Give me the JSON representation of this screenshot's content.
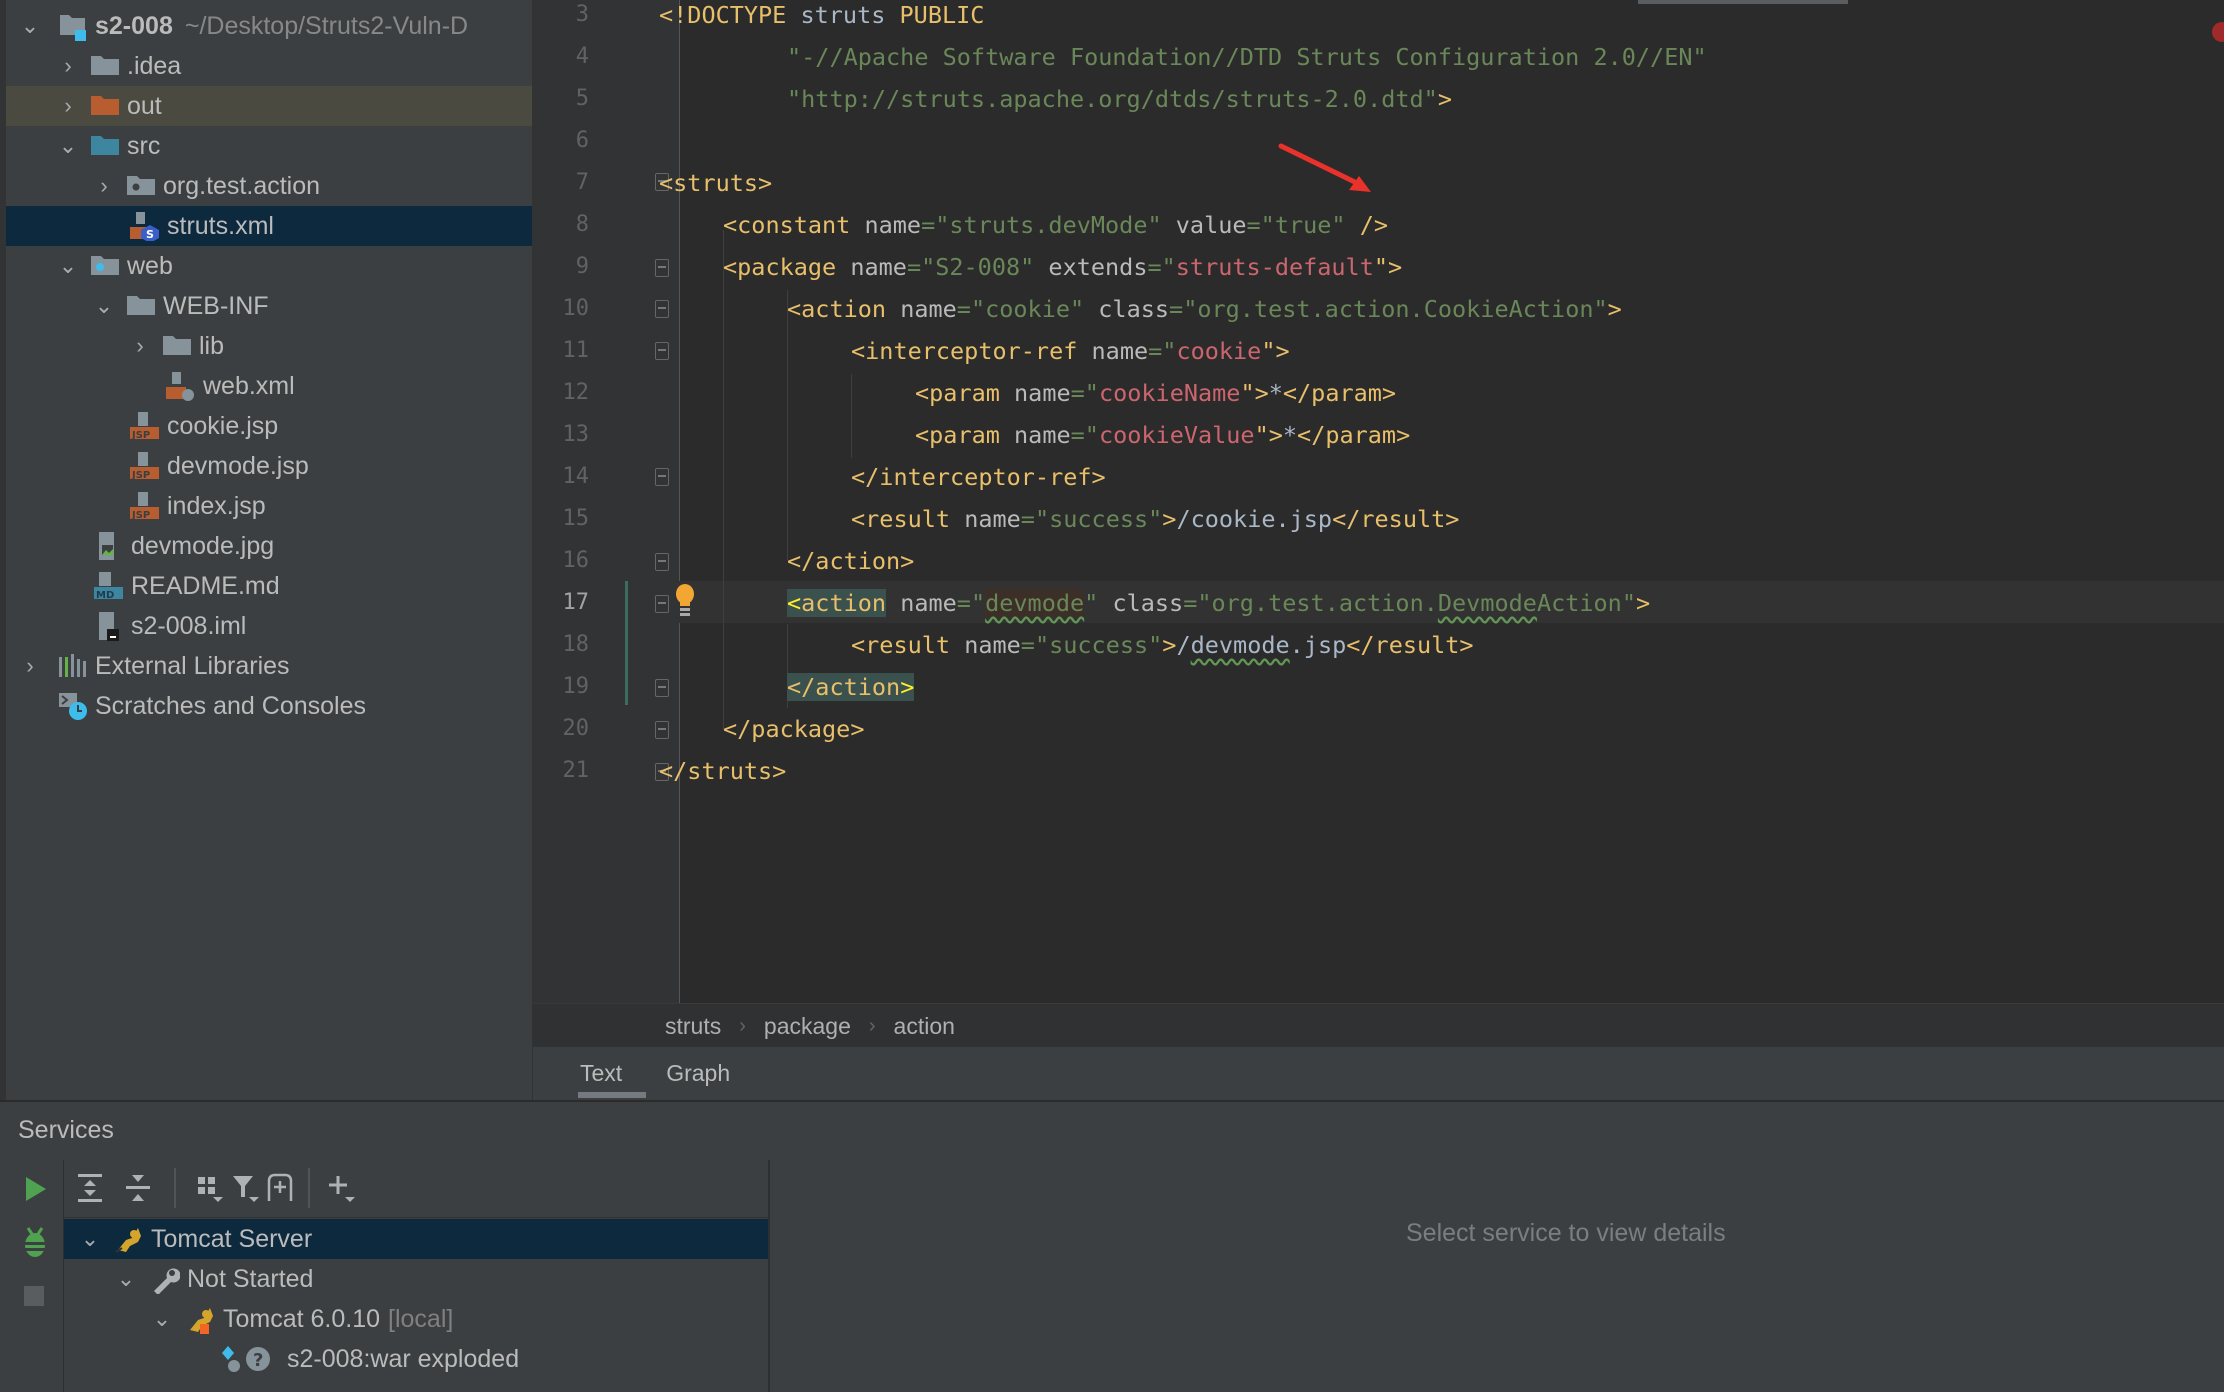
{
  "project": {
    "root": {
      "name": "s2-008",
      "path": "~/Desktop/Struts2-Vuln-D"
    },
    "items": [
      {
        "label": ".idea",
        "type": "folder",
        "expanded": false
      },
      {
        "label": "out",
        "type": "folder-excluded",
        "expanded": false
      },
      {
        "label": "src",
        "type": "folder-source",
        "expanded": true
      },
      {
        "label": "org.test.action",
        "type": "package",
        "expanded": false
      },
      {
        "label": "struts.xml",
        "type": "struts-xml",
        "selected": true
      },
      {
        "label": "web",
        "type": "folder-web",
        "expanded": true
      },
      {
        "label": "WEB-INF",
        "type": "folder",
        "expanded": true
      },
      {
        "label": "lib",
        "type": "folder",
        "expanded": false
      },
      {
        "label": "web.xml",
        "type": "web-xml"
      },
      {
        "label": "cookie.jsp",
        "type": "jsp"
      },
      {
        "label": "devmode.jsp",
        "type": "jsp"
      },
      {
        "label": "index.jsp",
        "type": "jsp"
      },
      {
        "label": "devmode.jpg",
        "type": "image"
      },
      {
        "label": "README.md",
        "type": "markdown"
      },
      {
        "label": "s2-008.iml",
        "type": "iml"
      },
      {
        "label": "External Libraries",
        "type": "libraries",
        "expanded": false
      },
      {
        "label": "Scratches and Consoles",
        "type": "scratches"
      }
    ]
  },
  "editor": {
    "current_line": 17,
    "lines": [
      {
        "n": "3"
      },
      {
        "n": "4"
      },
      {
        "n": "5"
      },
      {
        "n": "6"
      },
      {
        "n": "7"
      },
      {
        "n": "8"
      },
      {
        "n": "9"
      },
      {
        "n": "10"
      },
      {
        "n": "11"
      },
      {
        "n": "12"
      },
      {
        "n": "13"
      },
      {
        "n": "14"
      },
      {
        "n": "15"
      },
      {
        "n": "16"
      },
      {
        "n": "17"
      },
      {
        "n": "18"
      },
      {
        "n": "19"
      },
      {
        "n": "20"
      },
      {
        "n": "21"
      }
    ],
    "code": {
      "l3": {
        "open": "<!DOCTYPE",
        "kw": " struts ",
        "pub": "PUBLIC"
      },
      "l4": {
        "str": "\"-//Apache Software Foundation//DTD Struts Configuration 2.0//EN\""
      },
      "l5": {
        "str": "\"http://struts.apache.org/dtds/struts-2.0.dtd\"",
        "close": ">"
      },
      "l7": {
        "tag": "<struts>"
      },
      "l8": {
        "tag": "<constant",
        "a1": " name",
        "eq": "=",
        "v1": "\"struts.devMode\"",
        "a2": " value",
        "v2": "\"true\"",
        "end": " />"
      },
      "l9": {
        "tag": "<package",
        "a1": " name",
        "v1": "\"S2-008\"",
        "a2": " extends",
        "q": "\"",
        "v2": "struts-default",
        "end": "\">"
      },
      "l10": {
        "tag": "<action",
        "a1": " name",
        "v1": "\"cookie\"",
        "a2": " class",
        "v2": "\"org.test.action.CookieAction\"",
        "end": ">"
      },
      "l11": {
        "tag": "<interceptor-ref",
        "a1": " name",
        "q": "\"",
        "v1": "cookie",
        "end": "\">"
      },
      "l12": {
        "tag": "<param",
        "a1": " name",
        "q": "\"",
        "v1": "cookieName",
        "end": "\">",
        "text": "*",
        "close": "</param>"
      },
      "l13": {
        "tag": "<param",
        "a1": " name",
        "q": "\"",
        "v1": "cookieValue",
        "end": "\">",
        "text": "*",
        "close": "</param>"
      },
      "l14": {
        "tag": "</interceptor-ref>"
      },
      "l15": {
        "tag": "<result",
        "a1": " name",
        "v1": "\"success\"",
        "end": ">",
        "text": "/cookie.jsp",
        "close": "</result>"
      },
      "l16": {
        "tag": "</action>"
      },
      "l17": {
        "lt": "<",
        "tag": "action",
        "a1": " name",
        "q": "\"",
        "v1": "devmode",
        "a2": " class",
        "v2a": "\"org.test.action.",
        "v2b": "Devmode",
        "v2c": "Action\"",
        "end": ">"
      },
      "l18": {
        "tag": "<result",
        "a1": " name",
        "v1": "\"success\"",
        "end": ">",
        "t1": "/",
        "t2": "devmode",
        "t3": ".jsp",
        "close": "</result>"
      },
      "l19": {
        "tag": "</action",
        "gt": ">"
      },
      "l20": {
        "tag": "</package>"
      },
      "l21": {
        "tag": "</struts>"
      }
    }
  },
  "breadcrumb": [
    "struts",
    "package",
    "action"
  ],
  "view_tabs": [
    {
      "label": "Text",
      "active": true
    },
    {
      "label": "Graph",
      "active": false
    }
  ],
  "services": {
    "title": "Services",
    "tree": [
      {
        "label": "Tomcat Server",
        "selected": true
      },
      {
        "label": "Not Started"
      },
      {
        "label": "Tomcat 6.0.10",
        "suffix": "[local]"
      },
      {
        "label": "s2-008:war exploded"
      }
    ],
    "empty_detail": "Select service to view details"
  },
  "colors": {
    "tag": "#e8bf6a",
    "attr": "#bababa",
    "string": "#6a8759",
    "error_string": "#cc666e",
    "selection": "#0d293e",
    "annotation_arrow": "#e8322b"
  }
}
